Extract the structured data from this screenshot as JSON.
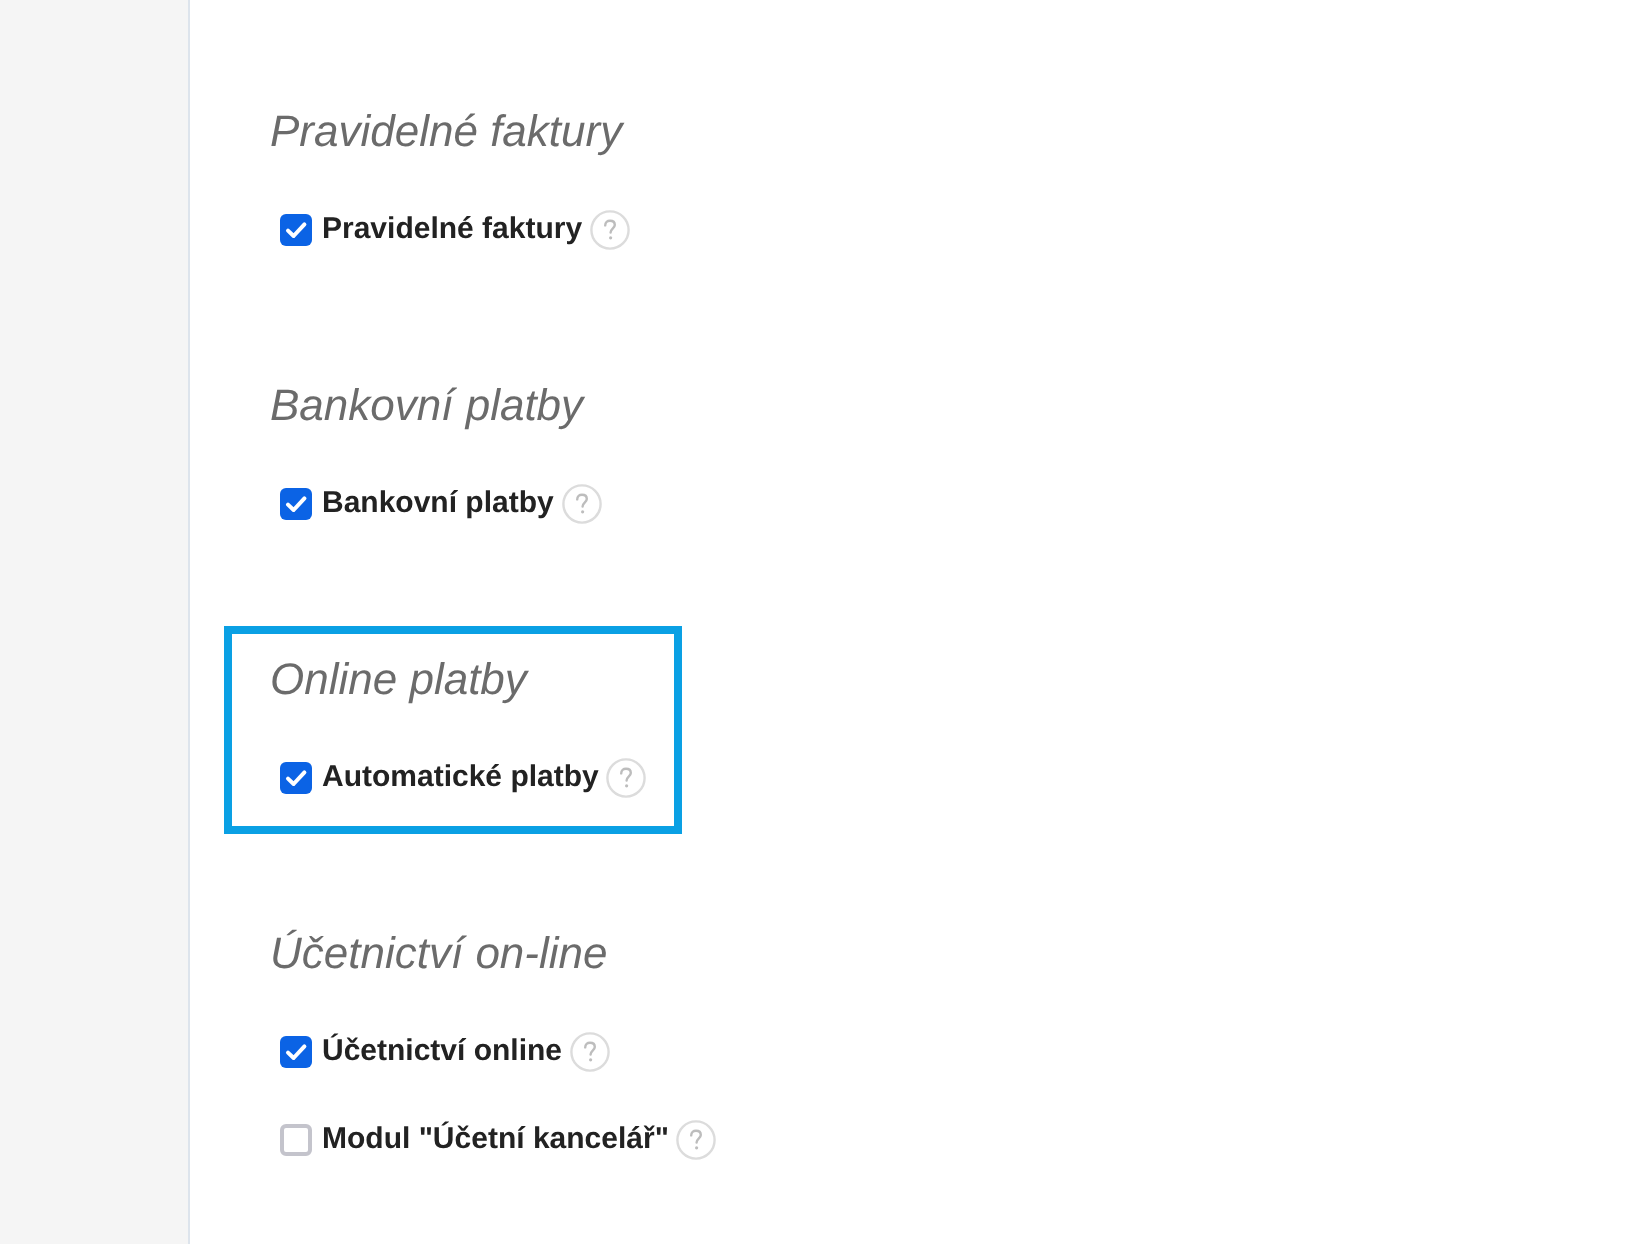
{
  "sections": [
    {
      "title": "Pravidelné faktury",
      "highlighted": false,
      "options": [
        {
          "label": "Pravidelné faktury",
          "checked": true
        }
      ]
    },
    {
      "title": "Bankovní platby",
      "highlighted": false,
      "options": [
        {
          "label": "Bankovní platby",
          "checked": true
        }
      ]
    },
    {
      "title": "Online platby",
      "highlighted": true,
      "options": [
        {
          "label": "Automatické platby",
          "checked": true
        }
      ]
    },
    {
      "title": "Účetnictví on-line",
      "highlighted": false,
      "options": [
        {
          "label": "Účetnictví online",
          "checked": true
        },
        {
          "label": "Modul \"Účetní kancelář\"",
          "checked": false
        }
      ]
    }
  ]
}
